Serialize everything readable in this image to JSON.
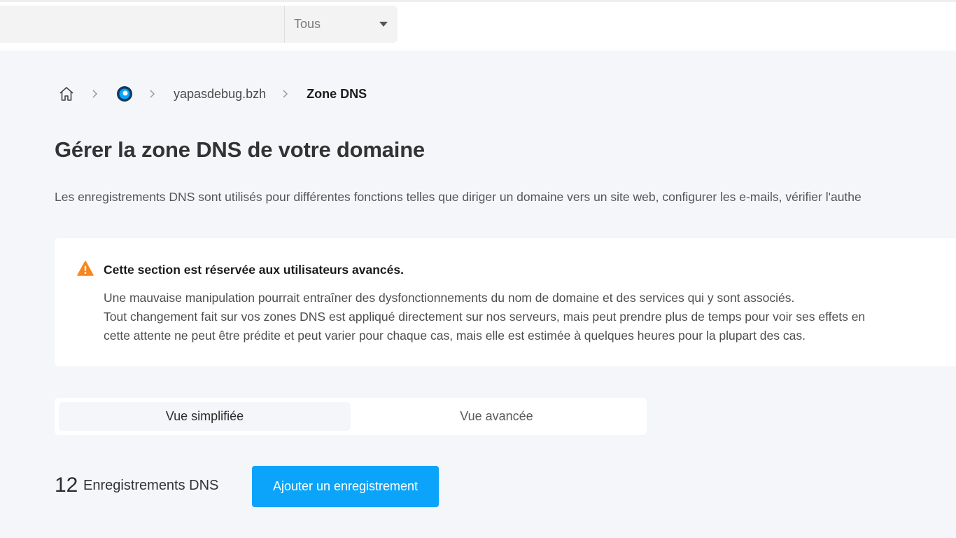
{
  "topbar": {
    "search_placeholder": "",
    "filter_value": "Tous"
  },
  "breadcrumb": {
    "domain": "yapasdebug.bzh",
    "current": "Zone DNS"
  },
  "page": {
    "title": "Gérer la zone DNS de votre domaine",
    "description": "Les enregistrements DNS sont utilisés pour différentes fonctions telles que diriger un domaine vers un site web, configurer les e-mails, vérifier l'authe"
  },
  "warning": {
    "title": "Cette section est réservée aux utilisateurs avancés.",
    "line1": "Une mauvaise manipulation pourrait entraîner des dysfonctionnements du nom de domaine et des services qui y sont associés.",
    "line2": "Tout changement fait sur vos zones DNS est appliqué directement sur nos serveurs, mais peut prendre plus de temps pour voir ses effets en",
    "line3": "cette attente ne peut être prédite et peut varier pour chaque cas, mais elle est estimée à quelques heures pour la plupart des cas."
  },
  "views": {
    "simple": "Vue simplifiée",
    "advanced": "Vue avancée"
  },
  "records": {
    "count": "12",
    "label": "Enregistrements DNS",
    "add_label": "Ajouter un enregistrement"
  },
  "colors": {
    "accent": "#0ba4fa",
    "warning": "#f7861e",
    "background": "#f5f6fa"
  }
}
